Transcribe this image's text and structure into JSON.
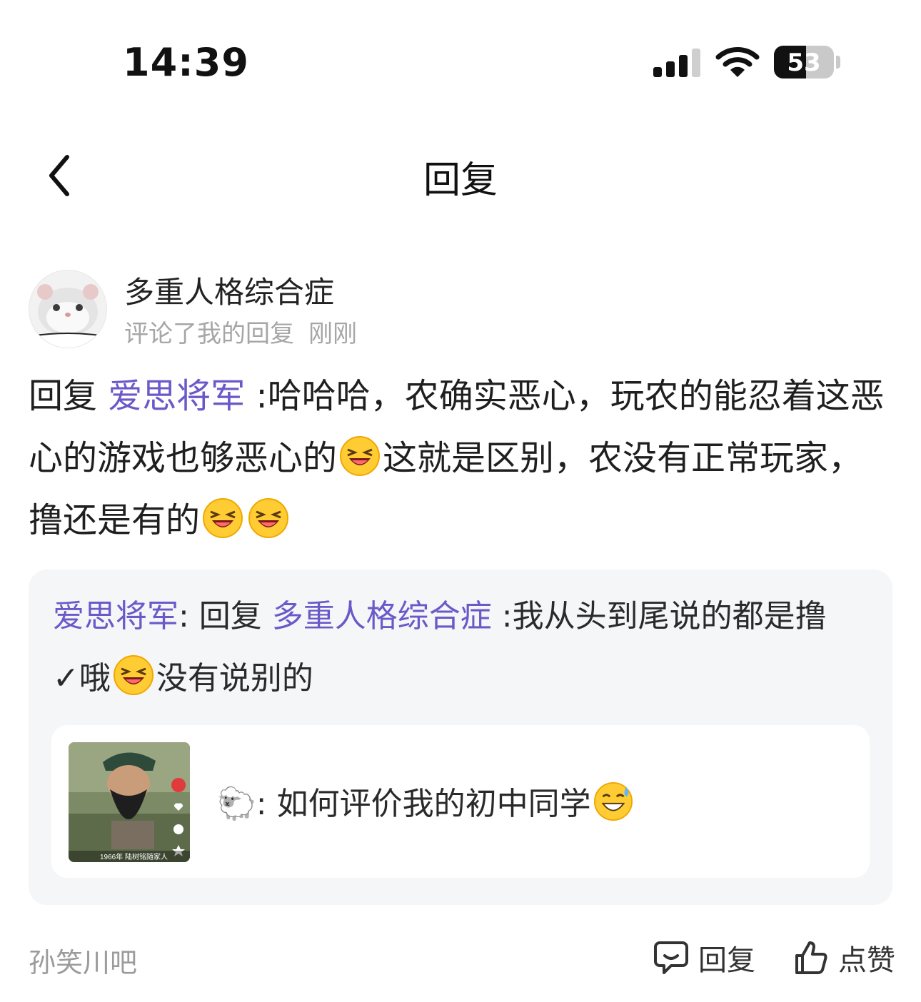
{
  "status_bar": {
    "time": "14:39",
    "battery": "53"
  },
  "nav": {
    "title": "回复"
  },
  "author": {
    "name": "多重人格综合症",
    "action": "评论了我的回复",
    "time": "刚刚"
  },
  "comment": {
    "prefix": "回复 ",
    "mention": "爱思将军",
    "text1": " :哈哈哈，农确实恶心，玩农的能忍着这恶心的游戏也够恶心的",
    "text2": "这就是区别，农没有正常玩家，撸还是有的"
  },
  "quote": {
    "user": "爱思将军",
    "sep": ": 回复 ",
    "mention": "多重人格综合症",
    "text1": " :我从头到尾说的都是撸✓哦",
    "text2": "没有说别的"
  },
  "card": {
    "prefix": "🐑",
    "text": ": 如何评价我的初中同学",
    "thumb_caption": "1966年 陆树铭随家人"
  },
  "footer": {
    "forum": "孙笑川吧",
    "reply": "回复",
    "like": "点赞"
  }
}
